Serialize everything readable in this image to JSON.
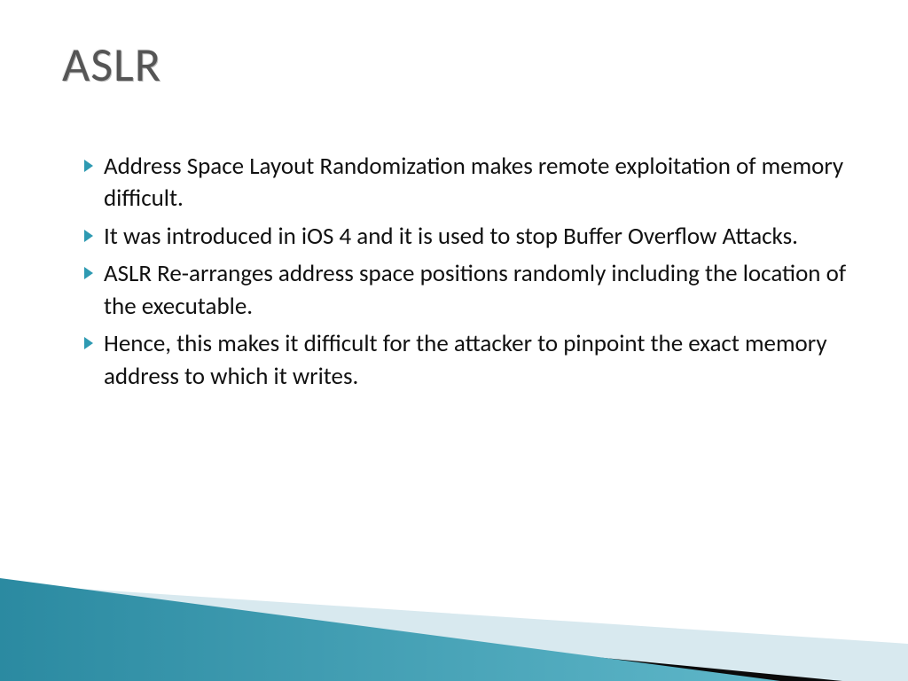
{
  "title": "ASLR",
  "bullets": [
    "Address Space Layout Randomization makes remote exploitation of memory difficult.",
    "It was introduced in iOS 4 and it is used to stop Buffer Overflow Attacks.",
    "ASLR Re-arranges address space positions randomly including the location of the executable.",
    "Hence, this makes it difficult for the attacker to pinpoint the exact memory address to which it writes."
  ],
  "theme": {
    "accent": "#2e9ab2",
    "wedge_light": "#d8e9ef",
    "wedge_dark": "#0a0a0a",
    "wedge_teal_a": "#2b8aa1",
    "wedge_teal_b": "#5fb7c9"
  }
}
